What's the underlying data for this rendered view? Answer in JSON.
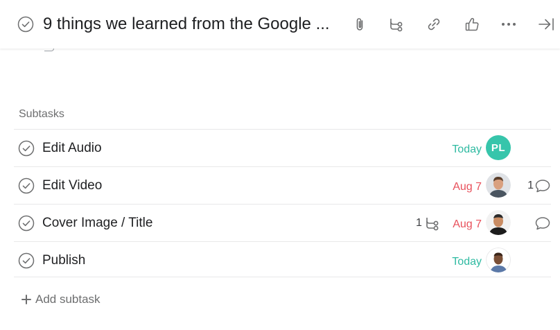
{
  "header": {
    "title": "9 things we learned from the Google ...",
    "icons": [
      "check-circle-icon",
      "paperclip-icon",
      "subtask-icon",
      "link-icon",
      "thumbs-up-icon",
      "more-icon",
      "close-pane-icon"
    ]
  },
  "subtasks": {
    "label": "Subtasks",
    "items": [
      {
        "name": "Edit Audio",
        "due": "Today",
        "due_status": "today",
        "assignee": {
          "initials": "PL",
          "color": "#37c5ab"
        },
        "comments": "",
        "subtasks": ""
      },
      {
        "name": "Edit Video",
        "due": "Aug 7",
        "due_status": "late",
        "assignee": {
          "initials": "",
          "photo": "avatar-photo"
        },
        "comments": "1",
        "subtasks": ""
      },
      {
        "name": "Cover Image / Title",
        "due": "Aug 7",
        "due_status": "late",
        "assignee": {
          "initials": "",
          "photo": "avatar-photo"
        },
        "comments": "",
        "subtasks": "1"
      },
      {
        "name": "Publish",
        "due": "Today",
        "due_status": "today",
        "assignee": {
          "initials": "",
          "photo": "avatar-photo"
        },
        "comments": "",
        "subtasks": ""
      }
    ],
    "add_label": "Add subtask"
  },
  "colors": {
    "today": "#2ebaa1",
    "late": "#e8505b",
    "muted": "#6d6e6f",
    "avatar_pl": "#37c5ab"
  }
}
